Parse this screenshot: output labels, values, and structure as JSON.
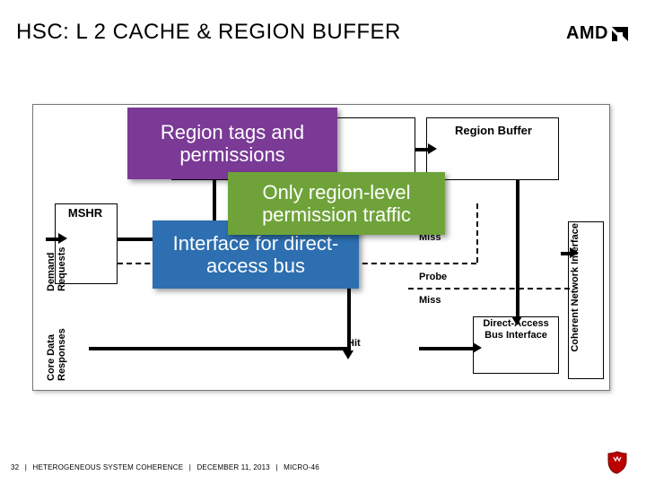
{
  "title": "HSC: L 2 CACHE & REGION BUFFER",
  "logo": {
    "text": "AMD"
  },
  "diagram": {
    "boxes": {
      "region_buffer": "Region Buffer",
      "mshr": "MSHR",
      "direct_access_bus_interface": "Direct-Access\nBus Interface",
      "coherent_network_interface": "Coherent Network Interface"
    },
    "side_labels": {
      "demand_requests": "Demand Requests",
      "core_data_responses": "Core Data Responses"
    },
    "signal_labels": {
      "hit": "Hit",
      "miss": "Miss",
      "probe": "Probe"
    }
  },
  "callouts": {
    "purple": "Region tags and permissions",
    "green": "Only region-level permission traffic",
    "blue": "Interface for direct-access bus"
  },
  "footer": {
    "page": "32",
    "sep": "|",
    "talk": "HETEROGENEOUS SYSTEM COHERENCE",
    "date": "DECEMBER 11, 2013",
    "venue": "MICRO-46"
  }
}
